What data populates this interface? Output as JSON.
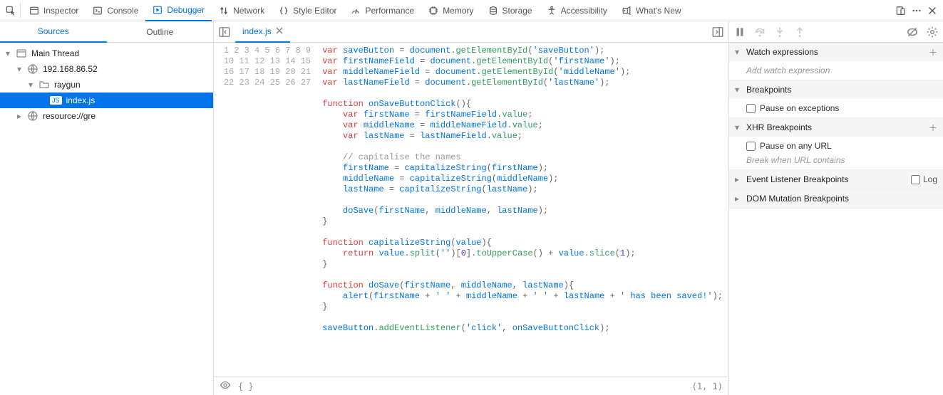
{
  "toolbar": {
    "tabs": [
      {
        "id": "inspector",
        "label": "Inspector"
      },
      {
        "id": "console",
        "label": "Console"
      },
      {
        "id": "debugger",
        "label": "Debugger",
        "active": true
      },
      {
        "id": "network",
        "label": "Network"
      },
      {
        "id": "styleeditor",
        "label": "Style Editor"
      },
      {
        "id": "performance",
        "label": "Performance"
      },
      {
        "id": "memory",
        "label": "Memory"
      },
      {
        "id": "storage",
        "label": "Storage"
      },
      {
        "id": "accessibility",
        "label": "Accessibility"
      },
      {
        "id": "whatsnew",
        "label": "What's New"
      }
    ]
  },
  "left_tabs": {
    "sources": "Sources",
    "outline": "Outline"
  },
  "tree": {
    "main_thread": "Main Thread",
    "origin": "192.168.86.52",
    "folder": "raygun",
    "file_badge": "JS",
    "file": "index.js",
    "resource": "resource://gre"
  },
  "editor_tab": {
    "filename": "index.js"
  },
  "cursor_pos": "(1, 1)",
  "pretty_print": "{ }",
  "code_lines": [
    {
      "n": 1,
      "html": "<span class='kw-red'>var</span> <span class='ident'>saveButton</span> <span class='punc'>=</span> <span class='ident'>document</span><span class='punc'>.</span><span class='prop'>getElementById</span><span class='punc'>(</span><span class='str'>'saveButton'</span><span class='punc'>);</span>"
    },
    {
      "n": 2,
      "html": "<span class='kw-red'>var</span> <span class='ident'>firstNameField</span> <span class='punc'>=</span> <span class='ident'>document</span><span class='punc'>.</span><span class='prop'>getElementById</span><span class='punc'>(</span><span class='str'>'firstName'</span><span class='punc'>);</span>"
    },
    {
      "n": 3,
      "html": "<span class='kw-red'>var</span> <span class='ident'>middleNameField</span> <span class='punc'>=</span> <span class='ident'>document</span><span class='punc'>.</span><span class='prop'>getElementById</span><span class='punc'>(</span><span class='str'>'middleName'</span><span class='punc'>);</span>"
    },
    {
      "n": 4,
      "html": "<span class='kw-red'>var</span> <span class='ident'>lastNameField</span> <span class='punc'>=</span> <span class='ident'>document</span><span class='punc'>.</span><span class='prop'>getElementById</span><span class='punc'>(</span><span class='str'>'lastName'</span><span class='punc'>);</span>"
    },
    {
      "n": 5,
      "html": ""
    },
    {
      "n": 6,
      "html": "<span class='kw-red'>function</span> <span class='ident'>onSaveButtonClick</span><span class='punc'>(){</span>"
    },
    {
      "n": 7,
      "html": "    <span class='kw-red'>var</span> <span class='ident'>firstName</span> <span class='punc'>=</span> <span class='ident'>firstNameField</span><span class='punc'>.</span><span class='prop'>value</span><span class='punc'>;</span>"
    },
    {
      "n": 8,
      "html": "    <span class='kw-red'>var</span> <span class='ident'>middleName</span> <span class='punc'>=</span> <span class='ident'>middleNameField</span><span class='punc'>.</span><span class='prop'>value</span><span class='punc'>;</span>"
    },
    {
      "n": 9,
      "html": "    <span class='kw-red'>var</span> <span class='ident'>lastName</span> <span class='punc'>=</span> <span class='ident'>lastNameField</span><span class='punc'>.</span><span class='prop'>value</span><span class='punc'>;</span>"
    },
    {
      "n": 10,
      "html": ""
    },
    {
      "n": 11,
      "html": "    <span class='com'>// capitalise the names</span>"
    },
    {
      "n": 12,
      "html": "    <span class='ident'>firstName</span> <span class='punc'>=</span> <span class='ident'>capitalizeString</span><span class='punc'>(</span><span class='ident'>firstName</span><span class='punc'>);</span>"
    },
    {
      "n": 13,
      "html": "    <span class='ident'>middleName</span> <span class='punc'>=</span> <span class='ident'>capitalizeString</span><span class='punc'>(</span><span class='ident'>middleName</span><span class='punc'>);</span>"
    },
    {
      "n": 14,
      "html": "    <span class='ident'>lastName</span> <span class='punc'>=</span> <span class='ident'>capitalizeString</span><span class='punc'>(</span><span class='ident'>lastName</span><span class='punc'>);</span>"
    },
    {
      "n": 15,
      "html": ""
    },
    {
      "n": 16,
      "html": "    <span class='ident'>doSave</span><span class='punc'>(</span><span class='ident'>firstName</span><span class='punc'>,</span> <span class='ident'>middleName</span><span class='punc'>,</span> <span class='ident'>lastName</span><span class='punc'>);</span>"
    },
    {
      "n": 17,
      "html": "<span class='punc'>}</span>"
    },
    {
      "n": 18,
      "html": ""
    },
    {
      "n": 19,
      "html": "<span class='kw-red'>function</span> <span class='ident'>capitalizeString</span><span class='punc'>(</span><span class='ident'>value</span><span class='punc'>){</span>"
    },
    {
      "n": 20,
      "html": "    <span class='kw-red'>return</span> <span class='ident'>value</span><span class='punc'>.</span><span class='prop'>split</span><span class='punc'>(</span><span class='str'>''</span><span class='punc'>)[</span><span class='num'>0</span><span class='punc'>].</span><span class='prop'>toUpperCase</span><span class='punc'>()</span> <span class='punc'>+</span> <span class='ident'>value</span><span class='punc'>.</span><span class='prop'>slice</span><span class='punc'>(</span><span class='num'>1</span><span class='punc'>);</span>"
    },
    {
      "n": 21,
      "html": "<span class='punc'>}</span>"
    },
    {
      "n": 22,
      "html": ""
    },
    {
      "n": 23,
      "html": "<span class='kw-red'>function</span> <span class='ident'>doSave</span><span class='punc'>(</span><span class='ident'>firstName</span><span class='punc'>,</span> <span class='ident'>middleName</span><span class='punc'>,</span> <span class='ident'>lastName</span><span class='punc'>){</span>"
    },
    {
      "n": 24,
      "html": "    <span class='ident'>alert</span><span class='punc'>(</span><span class='ident'>firstName</span> <span class='punc'>+</span> <span class='str'>' '</span> <span class='punc'>+</span> <span class='ident'>middleName</span> <span class='punc'>+</span> <span class='str'>' '</span> <span class='punc'>+</span> <span class='ident'>lastName</span> <span class='punc'>+</span> <span class='str'>' has been saved!'</span><span class='punc'>);</span>"
    },
    {
      "n": 25,
      "html": "<span class='punc'>}</span>"
    },
    {
      "n": 26,
      "html": ""
    },
    {
      "n": 27,
      "html": "<span class='ident'>saveButton</span><span class='punc'>.</span><span class='prop'>addEventListener</span><span class='punc'>(</span><span class='str'>'click'</span><span class='punc'>,</span> <span class='ident'>onSaveButtonClick</span><span class='punc'>);</span>"
    }
  ],
  "right": {
    "watch": {
      "title": "Watch expressions",
      "placeholder": "Add watch expression"
    },
    "breakpoints": {
      "title": "Breakpoints",
      "pause_exc": "Pause on exceptions"
    },
    "xhr": {
      "title": "XHR Breakpoints",
      "pause_any": "Pause on any URL",
      "placeholder": "Break when URL contains"
    },
    "evl": {
      "title": "Event Listener Breakpoints",
      "log": "Log"
    },
    "dom": {
      "title": "DOM Mutation Breakpoints"
    }
  }
}
